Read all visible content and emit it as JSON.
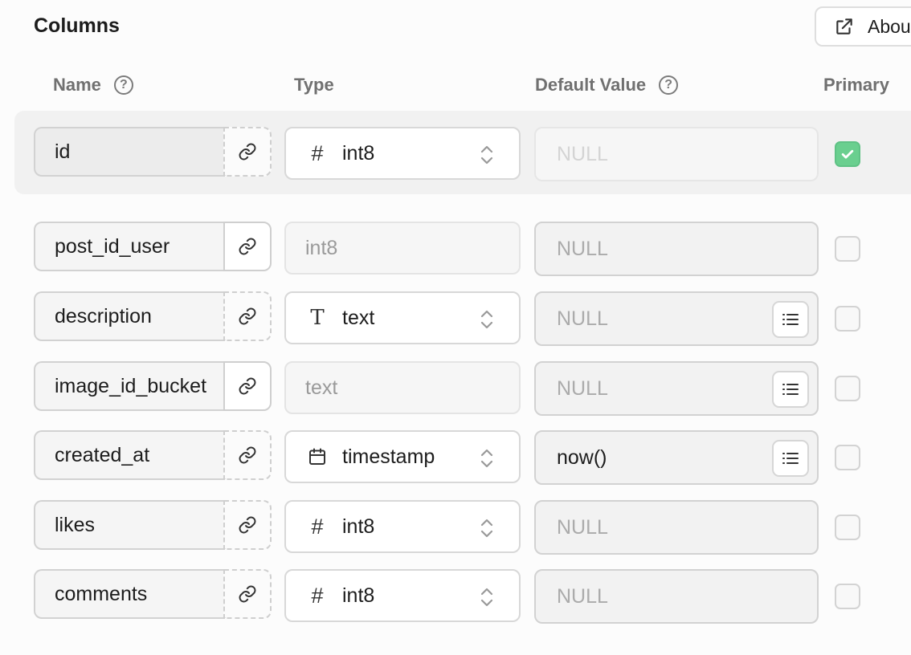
{
  "section": {
    "title": "Columns",
    "about_label": "About"
  },
  "headers": {
    "name": "Name",
    "type": "Type",
    "default_value": "Default Value",
    "primary": "Primary",
    "help_glyph": "?"
  },
  "icons": {
    "link": "link-icon",
    "external": "external-link-icon",
    "chevron": "chevron-up-down-icon",
    "suggest": "list-icon",
    "help": "help-icon",
    "check": "check-icon"
  },
  "colors": {
    "primary_check": "#6acf8f"
  },
  "rows": [
    {
      "name": "id",
      "type_icon": "#",
      "type": "int8",
      "default": "NULL",
      "primary": true
    },
    {
      "name": "post_id_user",
      "type_icon": "",
      "type": "int8",
      "default": "NULL",
      "primary": false
    },
    {
      "name": "description",
      "type_icon": "T",
      "type": "text",
      "default": "NULL",
      "primary": false
    },
    {
      "name": "image_id_bucket",
      "type_icon": "",
      "type": "text",
      "default": "NULL",
      "primary": false
    },
    {
      "name": "created_at",
      "type_icon": "calendar",
      "type": "timestamp",
      "default": "now()",
      "primary": false
    },
    {
      "name": "likes",
      "type_icon": "#",
      "type": "int8",
      "default": "NULL",
      "primary": false
    },
    {
      "name": "comments",
      "type_icon": "#",
      "type": "int8",
      "default": "NULL",
      "primary": false
    }
  ]
}
